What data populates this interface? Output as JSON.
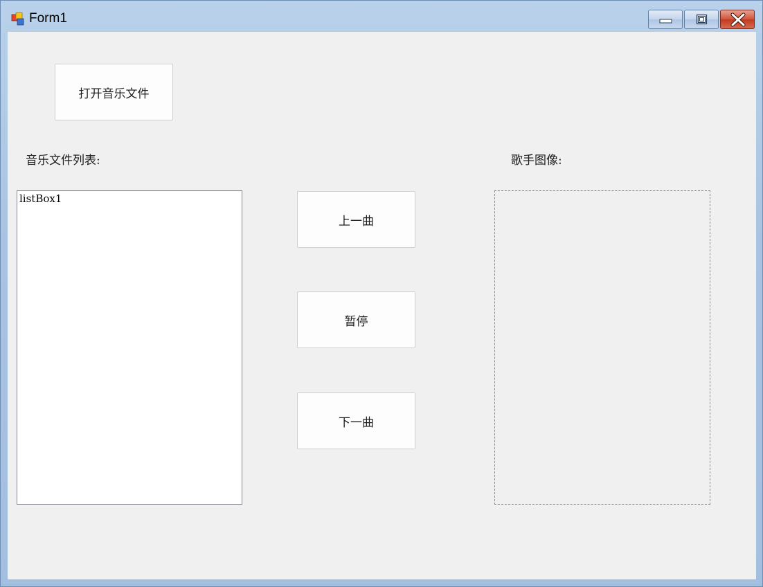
{
  "window": {
    "title": "Form1",
    "icons": {
      "app": "winforms-app-icon",
      "minimize": "minimize-icon",
      "maximize": "maximize-icon",
      "close": "close-icon"
    },
    "colors": {
      "client_background": "#f0f0f0",
      "close_button": "#c7432a"
    }
  },
  "form": {
    "open_button_label": "打开音乐文件",
    "music_list_label": "音乐文件列表:",
    "singer_image_label": "歌手图像:",
    "listbox": {
      "items": [
        "listBox1"
      ]
    },
    "previous_button_label": "上一曲",
    "pause_button_label": "暂停",
    "next_button_label": "下一曲"
  }
}
